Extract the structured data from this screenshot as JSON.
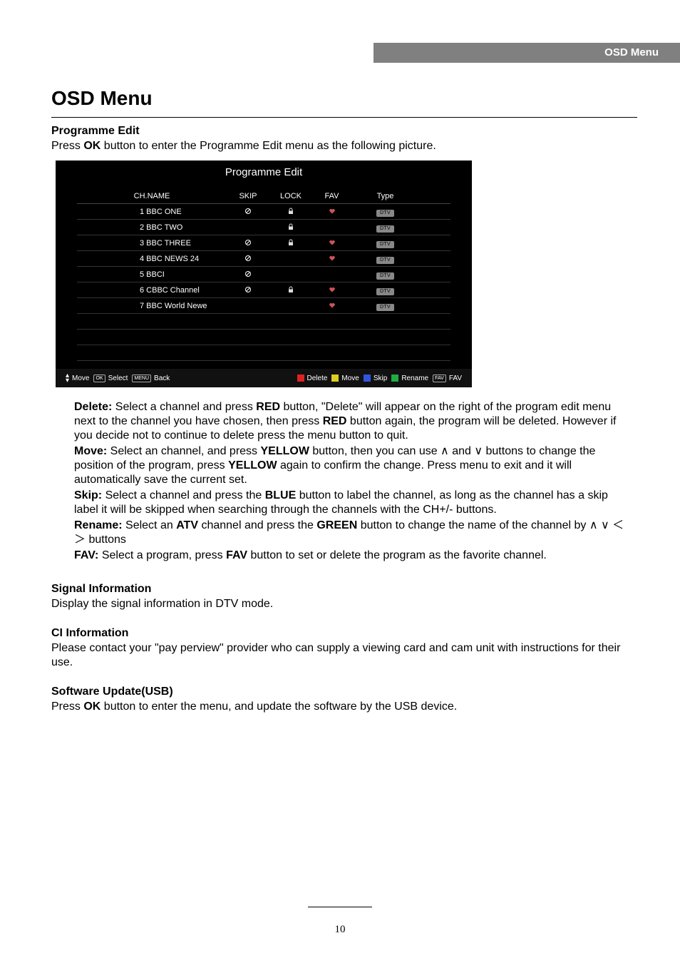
{
  "header": {
    "label": "OSD Menu"
  },
  "title": "OSD Menu",
  "programmeEdit": {
    "heading": "Programme Edit",
    "intro_pre": "Press ",
    "intro_bold": "OK",
    "intro_post": " button to enter the Programme Edit menu as the following picture."
  },
  "screenshot": {
    "title": "Programme Edit",
    "columns": {
      "name": "CH.NAME",
      "skip": "SKIP",
      "lock": "LOCK",
      "fav": "FAV",
      "type": "Type"
    },
    "dtv": "DTV",
    "rows": [
      {
        "name": "1 BBC ONE",
        "skip": true,
        "lock": true,
        "fav": true,
        "type": true
      },
      {
        "name": "2 BBC TWO",
        "skip": false,
        "lock": true,
        "fav": false,
        "type": true
      },
      {
        "name": "3 BBC THREE",
        "skip": true,
        "lock": true,
        "fav": true,
        "type": true
      },
      {
        "name": "4 BBC NEWS 24",
        "skip": true,
        "lock": false,
        "fav": true,
        "type": true
      },
      {
        "name": "5 BBCI",
        "skip": true,
        "lock": false,
        "fav": false,
        "type": true
      },
      {
        "name": "6 CBBC Channel",
        "skip": true,
        "lock": true,
        "fav": true,
        "type": true
      },
      {
        "name": "7 BBC World Newe",
        "skip": false,
        "lock": false,
        "fav": true,
        "type": true
      }
    ],
    "footer": {
      "move": "Move",
      "selectKey": "OK",
      "select": "Select",
      "backKey": "MENU",
      "back": "Back",
      "delete": "Delete",
      "moveAction": "Move",
      "skip": "Skip",
      "rename": "Rename",
      "favKey": "FAV",
      "fav": "FAV"
    }
  },
  "definitions": {
    "delete": {
      "label": "Delete:",
      "first": " Select a channel and press ",
      "bold1": "RED",
      "cont1": " button, \"Delete\" will appear on the right of the program edit menu next to the channel you have chosen, then press ",
      "bold2": "RED",
      "cont2": " button again, the program will be deleted. However if you decide not to continue to delete press the menu button to quit."
    },
    "move": {
      "label": "Move:",
      "first": " Select an channel, and press ",
      "bold1": "YELLOW",
      "mid1": " button, then you can use ∧ and ∨ buttons to change the position of the program, press ",
      "bold2": "YELLOW",
      "cont2": " again to confirm the change. Press menu to exit and it will automatically save the current set."
    },
    "skip": {
      "label": "Skip:",
      "first": " Select a channel and press the ",
      "bold1": "BLUE",
      "cont1": " button to label the channel, as long as the channel has a skip label it will be skipped when searching through the channels with the CH+/- buttons."
    },
    "rename": {
      "label": "Rename:",
      "first": " Select an ",
      "bold1": "ATV",
      "mid1": " channel and press the ",
      "bold2": "GREEN",
      "cont2": " button to change the name of the channel by  ∧ ∨ ＜ ＞ buttons"
    },
    "fav": {
      "label": "FAV:",
      "first": " Select a program, press ",
      "bold1": "FAV",
      "cont1": " button to set or delete the program as the favorite channel."
    }
  },
  "signal": {
    "heading": "Signal Information",
    "body": "Display the signal information in DTV mode."
  },
  "ci": {
    "heading": "CI Information",
    "body": "Please contact your \"pay perview\" provider who can supply a viewing card and cam unit with instructions for their use."
  },
  "software": {
    "heading": "Software Update(USB)",
    "pre": "Press ",
    "bold": "OK",
    "post": " button to enter the menu, and update the software by the USB device."
  },
  "pageNumber": "10"
}
